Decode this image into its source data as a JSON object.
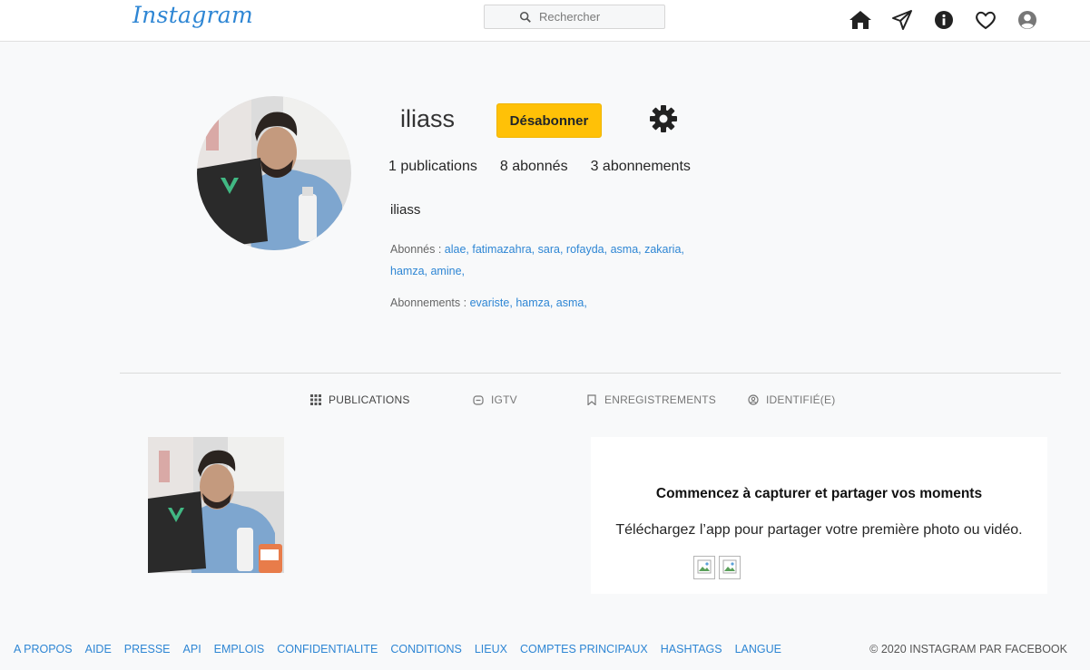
{
  "nav": {
    "logo": "Instagram",
    "search_placeholder": "Rechercher",
    "icons": [
      "home-icon",
      "direct-icon",
      "info-icon",
      "heart-icon",
      "account-icon"
    ]
  },
  "profile": {
    "username": "iliass",
    "unfollow_label": "Désabonner",
    "stats": {
      "publications": "1 publications",
      "followers": "8 abonnés",
      "following": "3 abonnements"
    },
    "fullname": "iliass",
    "followers_label": "Abonnés :",
    "followers": [
      "alae,",
      "fatimazahra,",
      "sara,",
      "rofayda,",
      "asma,",
      "zakaria,",
      "hamza,",
      "amine,"
    ],
    "following_label": "Abonnements :",
    "following": [
      "evariste,",
      "hamza,",
      "asma,"
    ]
  },
  "tabs": [
    {
      "label": "PUBLICATIONS",
      "icon": "grid-icon"
    },
    {
      "label": "IGTV",
      "icon": "igtv-icon"
    },
    {
      "label": "ENREGISTREMENTS",
      "icon": "bookmark-icon"
    },
    {
      "label": "IDENTIFIÉ(E)",
      "icon": "tagged-icon"
    }
  ],
  "empty_card": {
    "title": "Commencez à capturer et partager vos moments",
    "text": "Téléchargez l’app pour partager votre première photo ou vidéo."
  },
  "footer": {
    "links": [
      "A PROPOS",
      "AIDE",
      "PRESSE",
      "API",
      "EMPLOIS",
      "CONFIDENTIALITE",
      "CONDITIONS",
      "LIEUX",
      "COMPTES PRINCIPAUX",
      "HASHTAGS",
      "LANGUE"
    ],
    "copyright": "© 2020 INSTAGRAM PAR FACEBOOK"
  },
  "colors": {
    "accent": "#2e86d4",
    "button": "#ffc107",
    "background": "#f8f9fa"
  }
}
